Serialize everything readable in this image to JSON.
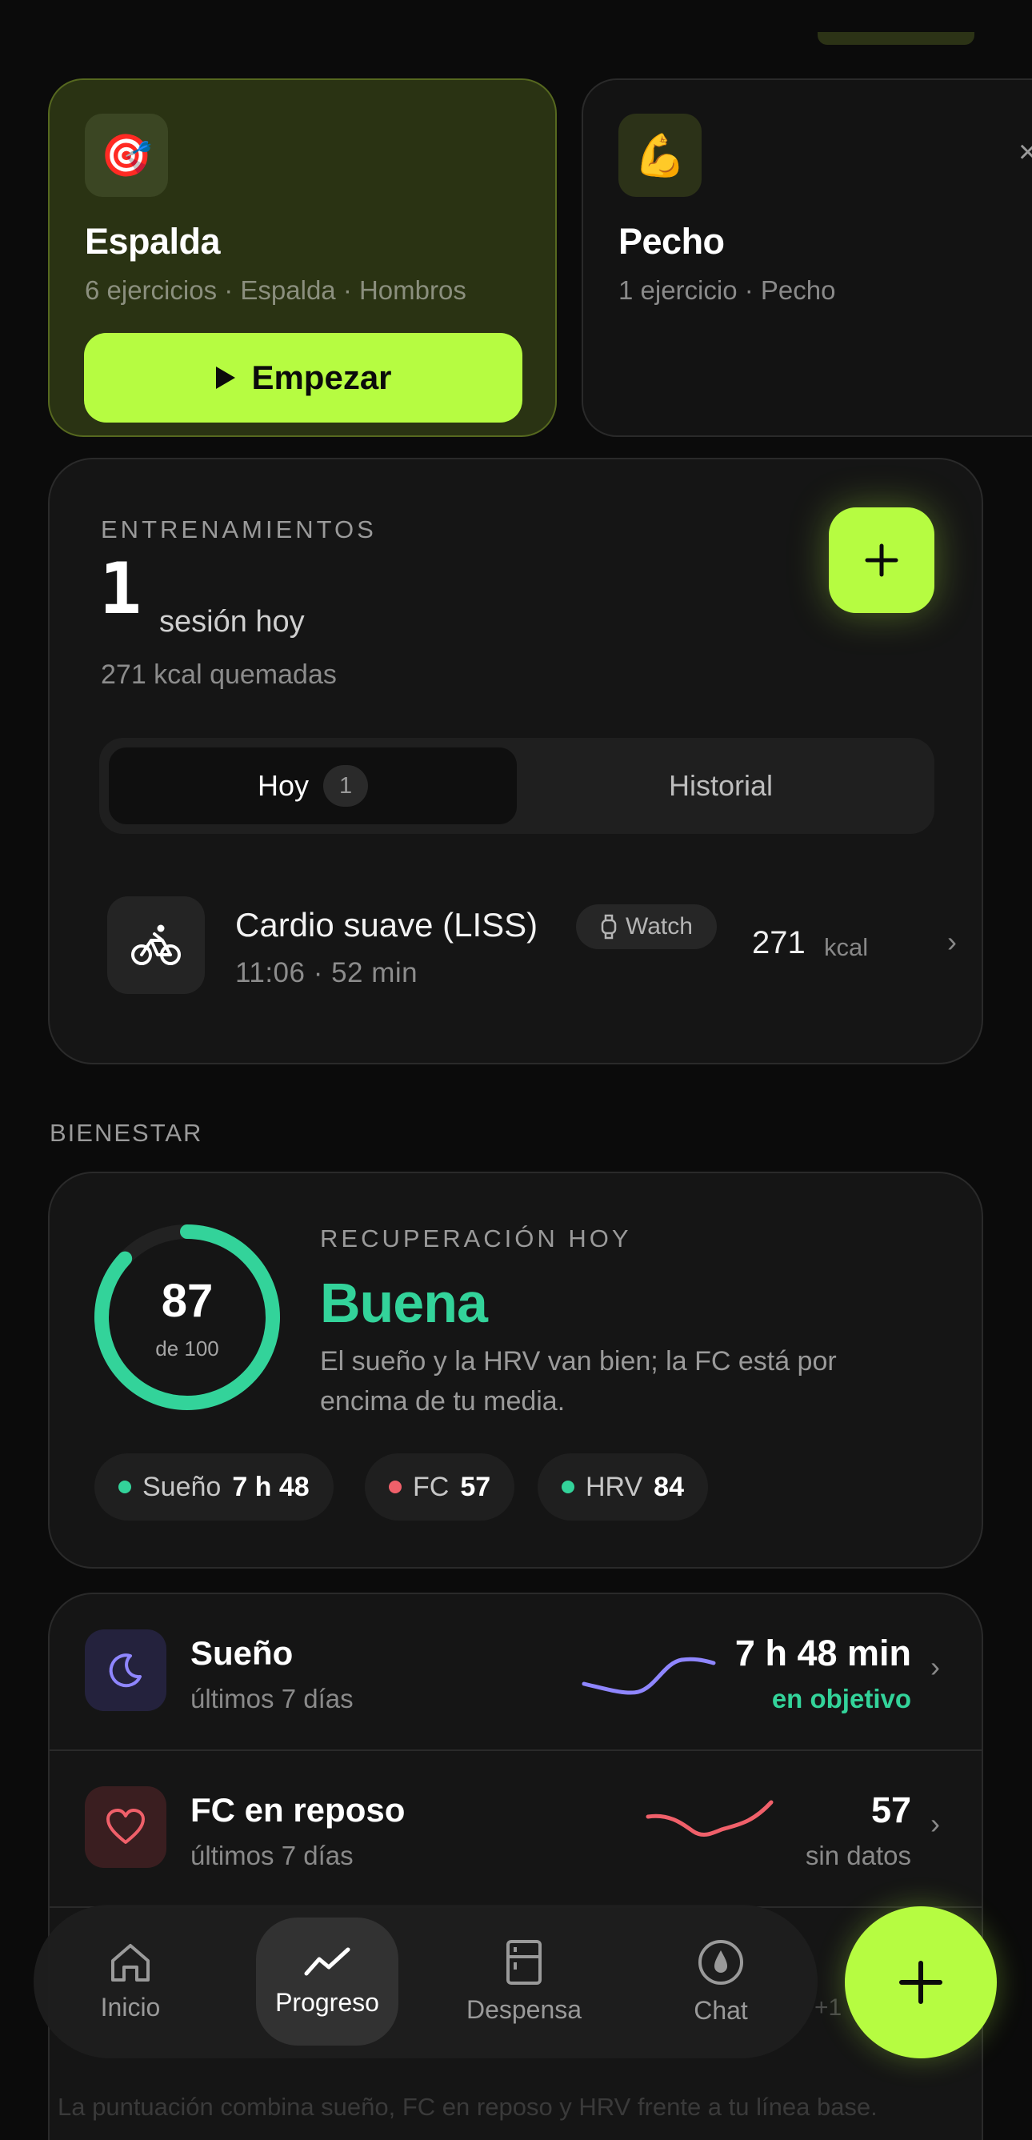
{
  "routines": [
    {
      "icon": "🎯",
      "title": "Espalda",
      "subtitle": "6 ejercicios · Espalda · Hombros",
      "button_label": "Empezar"
    },
    {
      "icon": "💪",
      "title": "Pecho",
      "subtitle": "1 ejercicio · Pecho",
      "close": "×"
    }
  ],
  "workouts": {
    "eyebrow": "ENTRENAMIENTOS",
    "count": "1",
    "count_label": "sesión hoy",
    "kcal_burned": "271 kcal quemadas",
    "add_label": "+",
    "tabs": [
      {
        "label": "Hoy",
        "badge": "1"
      },
      {
        "label": "Historial"
      }
    ],
    "items": [
      {
        "name": "Cardio suave (LISS)",
        "source": "Watch",
        "meta": "11:06 · 52 min",
        "kcal": "271",
        "kcal_unit": "kcal"
      }
    ]
  },
  "wellbeing": {
    "section_title": "BIENESTAR",
    "recovery": {
      "eyebrow": "RECUPERACIÓN HOY",
      "score": "87",
      "score_of": "de 100",
      "score_fraction": 0.87,
      "status": "Buena",
      "description": "El sueño y la HRV van bien; la FC está por encima de tu media.",
      "pills": [
        {
          "label": "Sueño",
          "value": "7 h 48",
          "color": "#33d39a"
        },
        {
          "label": "FC",
          "value": "57",
          "color": "#f0606a"
        },
        {
          "label": "HRV",
          "value": "84",
          "color": "#33d39a"
        }
      ]
    },
    "metrics": [
      {
        "title": "Sueño",
        "subtitle": "últimos 7 días",
        "value": "7 h 48 min",
        "note": "en objetivo",
        "note_color": "#33d39a",
        "color": "#8f86ff",
        "icon": "moon-icon"
      },
      {
        "title": "FC en reposo",
        "subtitle": "últimos 7 días",
        "value": "57",
        "note": "sin datos",
        "note_color": "#8a8a8a",
        "color": "#f0606a",
        "icon": "heart-icon"
      }
    ],
    "footnote": "La puntuación combina sueño, FC en reposo y HRV frente a tu línea base."
  },
  "nav": {
    "items": [
      {
        "label": "Inicio",
        "icon": "home-icon"
      },
      {
        "label": "Progreso",
        "icon": "trend-icon",
        "active": true
      },
      {
        "label": "Despensa",
        "icon": "fridge-icon"
      },
      {
        "label": "Chat",
        "icon": "chat-icon"
      }
    ],
    "fab_label": "+",
    "peek": "+1"
  },
  "colors": {
    "accent": "#b6fc41",
    "good": "#33d39a",
    "background": "#0b0b0b"
  }
}
